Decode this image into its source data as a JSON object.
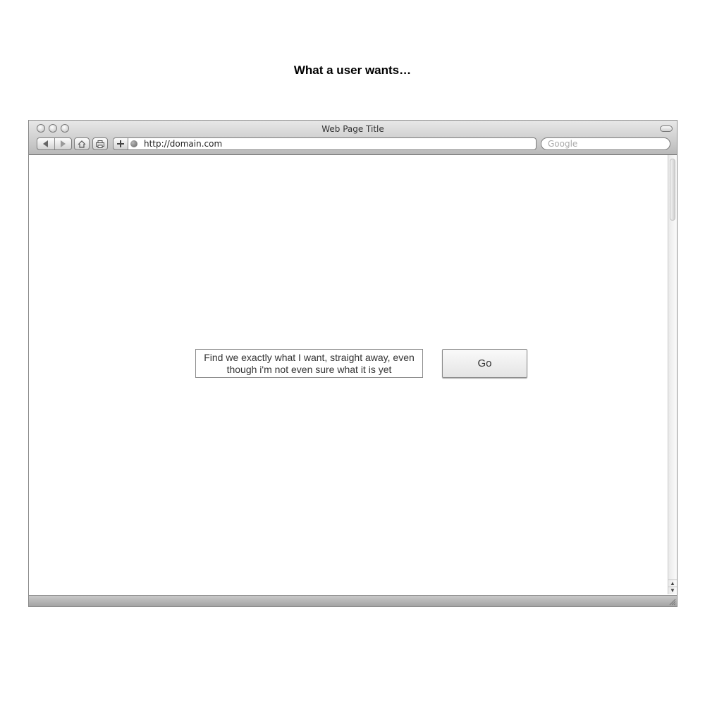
{
  "heading": "What a user wants…",
  "window": {
    "title": "Web Page Title"
  },
  "toolbar": {
    "address": "http://domain.com",
    "search_placeholder": "Google",
    "icons": [
      "back-icon",
      "forward-icon",
      "home-icon",
      "print-icon",
      "add-bookmark-icon",
      "globe-icon"
    ]
  },
  "content": {
    "query_text": "Find we exactly what I want, straight away, even though i'm not even sure what it is yet",
    "go_label": "Go"
  },
  "scrollbar": {
    "up_arrow": "▲",
    "down_arrow": "▼"
  }
}
